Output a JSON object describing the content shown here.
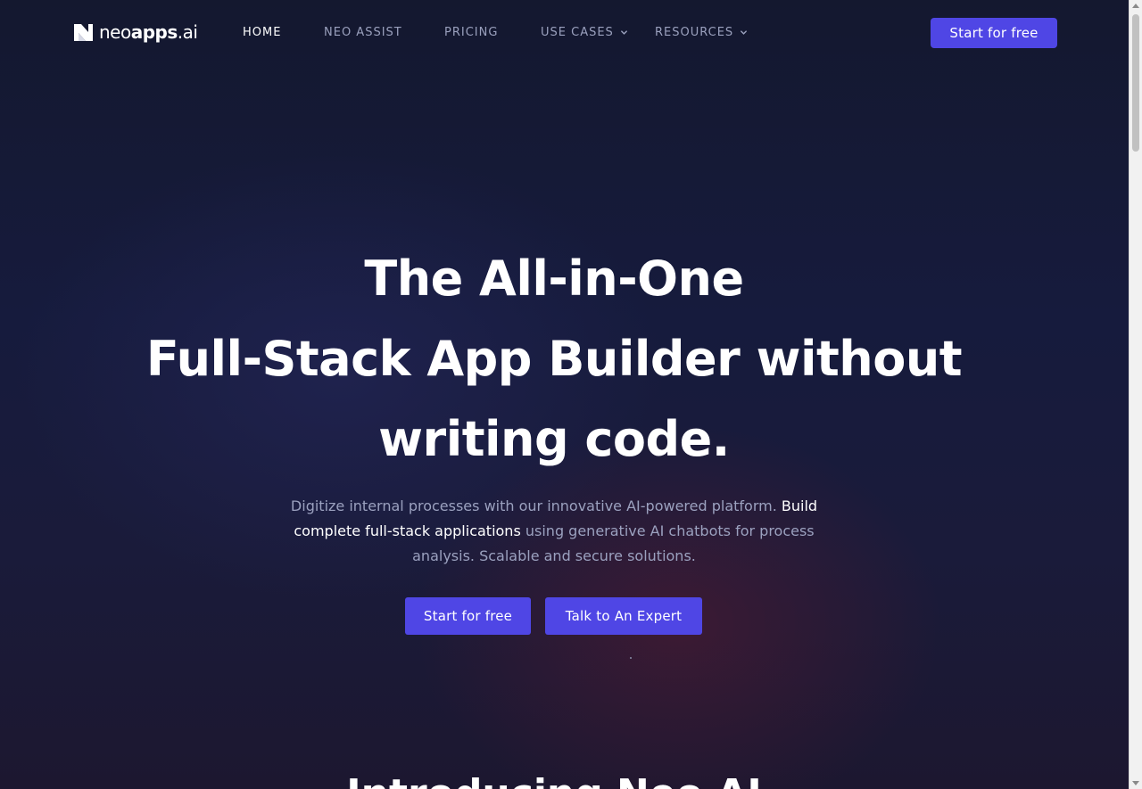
{
  "nav": {
    "logo_light": "neo",
    "logo_strong": "apps",
    "logo_suffix": ".ai",
    "items": [
      {
        "label": "HOME",
        "active": true
      },
      {
        "label": "NEO ASSIST",
        "active": false
      },
      {
        "label": "PRICING",
        "active": false
      },
      {
        "label": "USE CASES",
        "active": false,
        "dropdown": true
      },
      {
        "label": "RESOURCES",
        "active": false,
        "dropdown": true
      }
    ],
    "cta_label": "Start for free"
  },
  "hero": {
    "title_lines": [
      "The All-in-One",
      "Full-Stack App Builder without",
      "writing code."
    ],
    "subtitle_part1": "Digitize internal processes with our innovative AI-powered platform.",
    "subtitle_highlight": "Build complete full-stack applications",
    "subtitle_part2": "using generative AI chatbots for process analysis. Scalable and secure solutions.",
    "primary_button": "Start for free",
    "secondary_button": "Talk to An Expert"
  },
  "next_section": {
    "heading": "Introducing Neo AI"
  },
  "colors": {
    "accent": "#4f46e5",
    "background": "#151a3a",
    "muted_text": "#9ba1bf"
  },
  "icons": {
    "logo": "neoapps-logo-icon",
    "dropdown": "chevron-down-icon"
  }
}
